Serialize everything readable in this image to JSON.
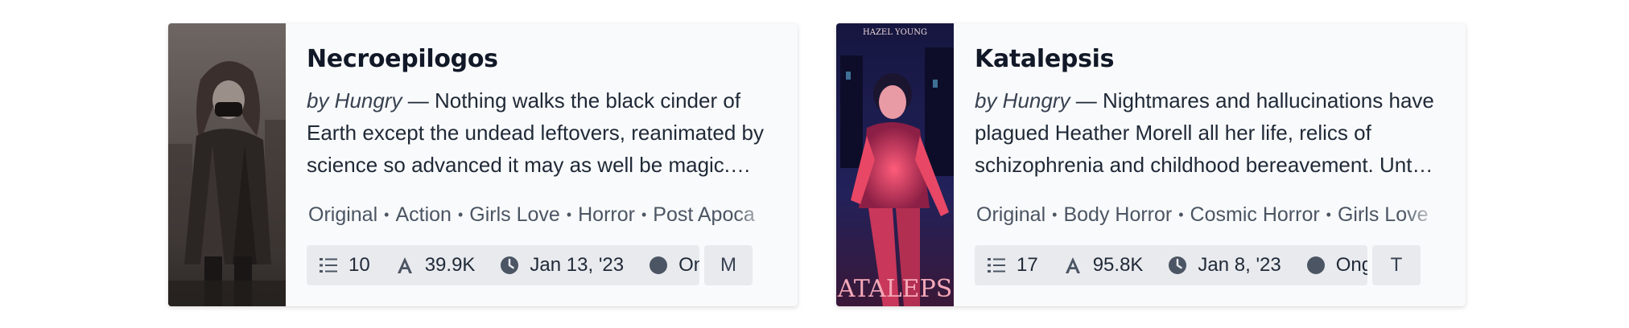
{
  "cards": [
    {
      "title": "Necroepilogos",
      "author": "by Hungry",
      "separator": " — ",
      "description": "Nothing walks the black cinder of Earth except the undead leftovers, reanimated by science so advanced it may as well be magic.…",
      "tags": [
        "Original",
        "Action",
        "Girls Love",
        "Horror",
        "Post Apoca"
      ],
      "stats": {
        "chapters": "10",
        "words": "39.9K",
        "updated": "Jan 13, '23",
        "status": "On…"
      },
      "extra_label": "M",
      "cover": {
        "text": "",
        "palette": [
          "#5a514e",
          "#2a2523",
          "#8d8480"
        ]
      }
    },
    {
      "title": "Katalepsis",
      "author": "by Hungry",
      "separator": " — ",
      "description": "Nightmares and hallucinations have plagued Heather Morell all her life, relics of schizophrenia and childhood bereavement. Unt…",
      "tags": [
        "Original",
        "Body Horror",
        "Cosmic Horror",
        "Girls Love"
      ],
      "stats": {
        "chapters": "17",
        "words": "95.8K",
        "updated": "Jan 8, '23",
        "status": "Ong…"
      },
      "extra_label": "T",
      "cover": {
        "top_text": "HAZEL YOUNG",
        "bottom_text": "ATALEPS",
        "palette": [
          "#0f1030",
          "#e8405f",
          "#2b2a6a"
        ]
      }
    }
  ],
  "icons": {
    "chapters": "list-icon",
    "words": "letter-a-icon",
    "updated": "clock-icon",
    "status": "status-dot-icon"
  },
  "colors": {
    "card_bg": "#f9fafb",
    "stat_bg": "#e9eaee",
    "title": "#111827",
    "tag_text": "#4b5563"
  }
}
